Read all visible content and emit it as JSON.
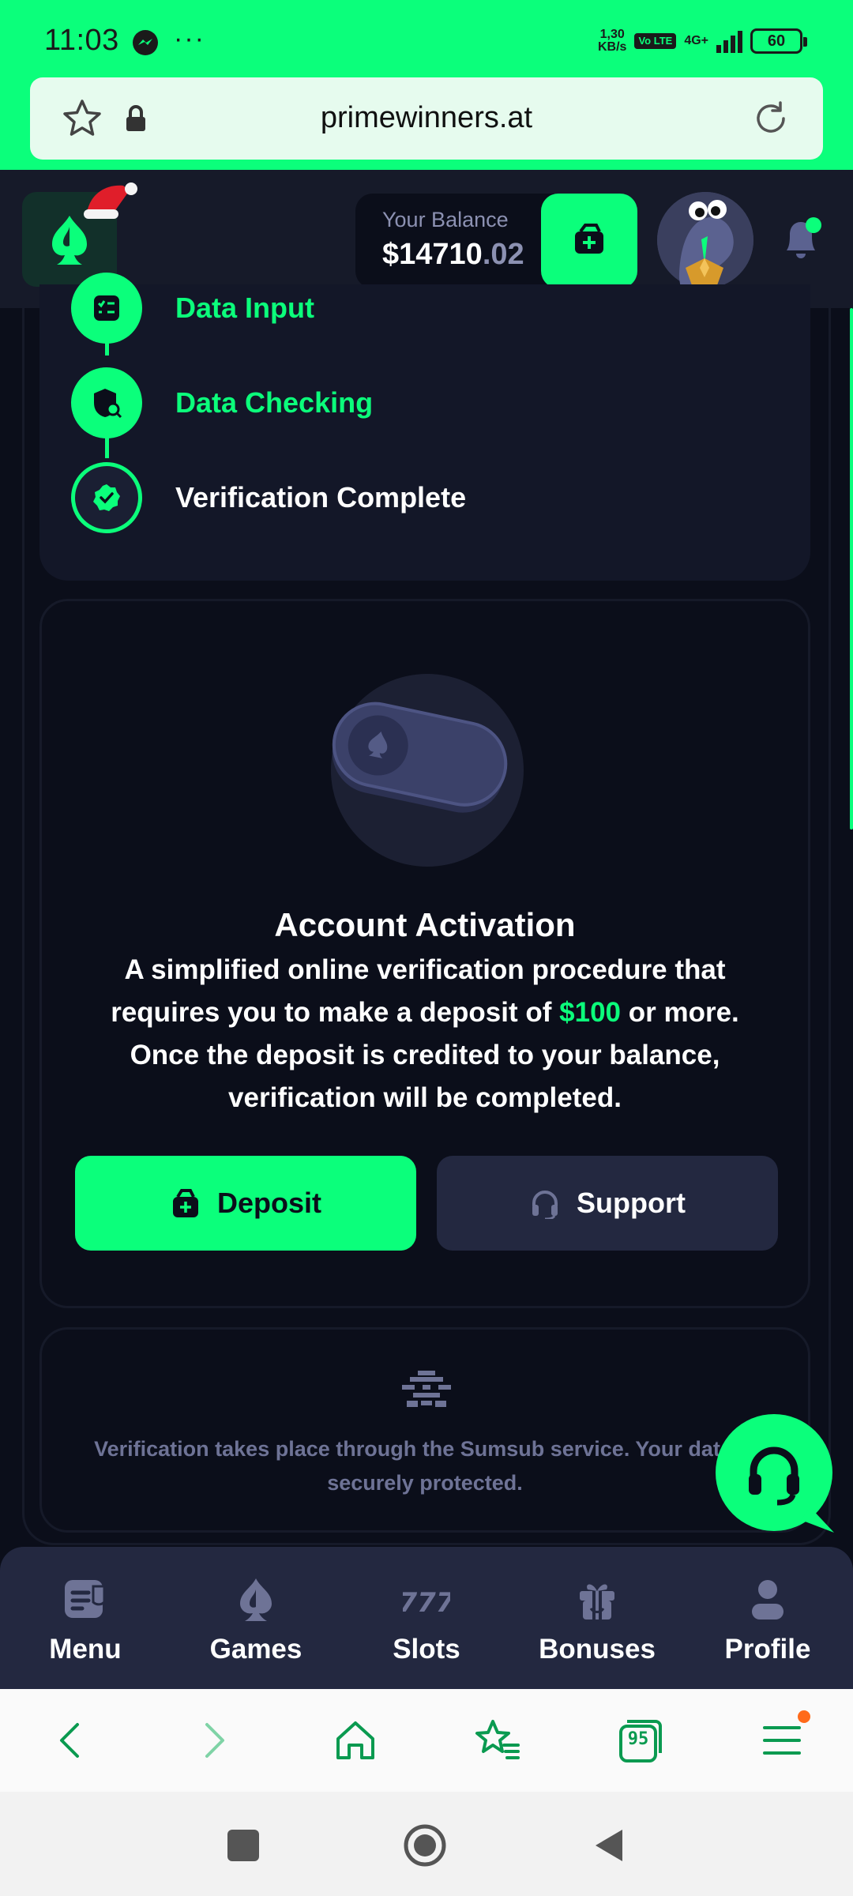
{
  "status_bar": {
    "time": "11:03",
    "dots": "···",
    "net_speed_value": "1,30",
    "net_speed_unit": "KB/s",
    "volte": "Vo LTE",
    "network": "4G+",
    "battery": "60"
  },
  "browser": {
    "url": "primewinners.at",
    "tab_count": "95"
  },
  "header": {
    "balance_label": "Your Balance",
    "balance_whole": "$14710",
    "balance_cents": ".02"
  },
  "steps": [
    {
      "label": "Data Input",
      "state": "active"
    },
    {
      "label": "Data Checking",
      "state": "active"
    },
    {
      "label": "Verification Complete",
      "state": "done"
    }
  ],
  "activation": {
    "title": "Account Activation",
    "body_part1": "A simplified online verification procedure that requires you to make a deposit of ",
    "body_amount": "$100",
    "body_part2": " or more. Once the deposit is credited to your balance, verification will be completed.",
    "deposit_label": "Deposit",
    "support_label": "Support"
  },
  "sumsub": {
    "text": "Verification takes place through the Sumsub service. Your data is securely protected."
  },
  "bottom_nav": [
    {
      "label": "Menu",
      "icon": "menu-icon"
    },
    {
      "label": "Games",
      "icon": "games-icon"
    },
    {
      "label": "Slots",
      "icon": "slots-icon"
    },
    {
      "label": "Bonuses",
      "icon": "bonuses-icon"
    },
    {
      "label": "Profile",
      "icon": "profile-icon"
    }
  ],
  "colors": {
    "accent": "#0bff7b",
    "background": "#0b0e1a",
    "panel": "#161a29",
    "muted": "#8c91b2"
  }
}
